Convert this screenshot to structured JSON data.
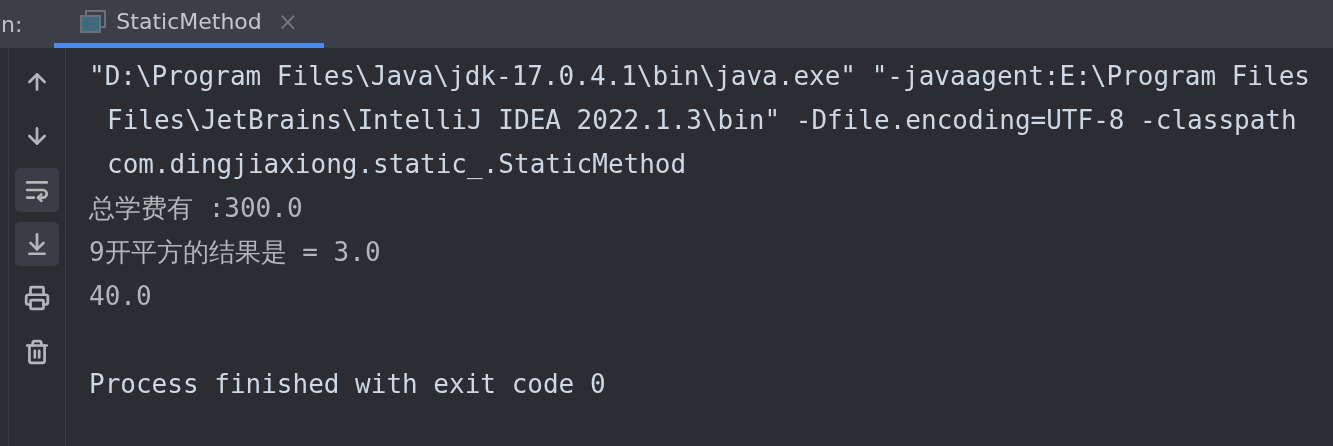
{
  "tool_window": {
    "label": "n:"
  },
  "tabs": [
    {
      "label": "StaticMethod",
      "selected": true,
      "close": "×"
    }
  ],
  "toolbar": [
    {
      "kind": "up",
      "selected": false
    },
    {
      "kind": "down",
      "selected": false
    },
    {
      "kind": "wrap",
      "selected": true
    },
    {
      "kind": "scroll-end",
      "selected": true
    },
    {
      "kind": "print",
      "selected": false
    },
    {
      "kind": "trash",
      "selected": false
    }
  ],
  "console": {
    "command": [
      "\"D:\\Program Files\\Java\\jdk-17.0.4.1\\bin\\java.exe\" \"-javaagent:E:\\Program Files",
      "Files\\JetBrains\\IntelliJ IDEA 2022.1.3\\bin\" -Dfile.encoding=UTF-8 -classpath",
      "com.dingjiaxiong.static_.StaticMethod"
    ],
    "output": [
      "总学费有 :300.0",
      "9开平方的结果是 = 3.0",
      "40.0"
    ],
    "exit_message": "Process finished with exit code 0"
  }
}
